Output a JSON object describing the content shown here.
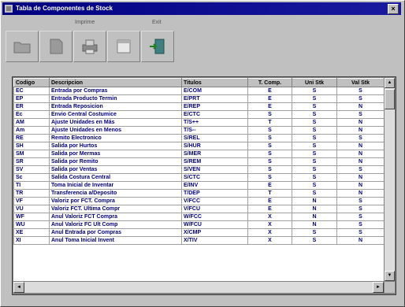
{
  "window": {
    "title": "Tabla de Componentes de Stock",
    "close_label": "×"
  },
  "toolbar": {
    "menu_labels": [
      "Imprime",
      "Exit"
    ],
    "buttons": [
      {
        "icon": "folder-icon"
      },
      {
        "icon": "document-icon"
      },
      {
        "icon": "printer-icon"
      },
      {
        "icon": "window-icon"
      },
      {
        "icon": "exit-door-icon"
      }
    ]
  },
  "grid": {
    "columns": [
      "Codigo",
      "Descripcion",
      "Titulos",
      "T. Comp.",
      "Uni Stk",
      "Val Stk"
    ],
    "rows": [
      [
        "EC",
        "Entrada por Compras",
        "E/COM",
        "E",
        "S",
        "S"
      ],
      [
        "EP",
        "Entrada Producto Termin",
        "E/PRT",
        "E",
        "S",
        "S"
      ],
      [
        "ER",
        "Entrada Reposicion",
        "E/REP",
        "E",
        "S",
        "N"
      ],
      [
        "Ec",
        "Envio Central Costumice",
        "E/CTC",
        "S",
        "S",
        "S"
      ],
      [
        "AM",
        "Ajuste Unidades en Más",
        "T/S++",
        "T",
        "S",
        "N"
      ],
      [
        "Am",
        "Ajuste Unidades en Menos",
        "T/S--",
        "S",
        "S",
        "N"
      ],
      [
        "RE",
        "Remito Electronico",
        "S/REL",
        "S",
        "S",
        "S"
      ],
      [
        "SH",
        "Salida por Hurtos",
        "S/HUR",
        "S",
        "S",
        "N"
      ],
      [
        "SM",
        "Salida por Mermas",
        "S/MER",
        "S",
        "S",
        "N"
      ],
      [
        "SR",
        "Salida por Remito",
        "S/REM",
        "S",
        "S",
        "N"
      ],
      [
        "SV",
        "Salida por Ventas",
        "S/VEN",
        "S",
        "S",
        "S"
      ],
      [
        "Sc",
        "Salida Costura Central",
        "S/CTC",
        "S",
        "S",
        "N"
      ],
      [
        "TI",
        "Toma Inicial de Inventar",
        "E/INV",
        "E",
        "S",
        "N"
      ],
      [
        "TR",
        "Transferencia a/Deposito",
        "T/DEP",
        "T",
        "S",
        "N"
      ],
      [
        "VF",
        "Valoriz por FCT. Compra",
        "V/FCC",
        "E",
        "N",
        "S"
      ],
      [
        "VU",
        "Valoriz FCT. Ultima Compr",
        "V/FCU",
        "E",
        "N",
        "S"
      ],
      [
        "WF",
        "Anul Valoriz FCT Compra",
        "W/FCC",
        "X",
        "N",
        "S"
      ],
      [
        "WU",
        "Anul Valoriz FC Ult Comp",
        "W/FCU",
        "X",
        "N",
        "S"
      ],
      [
        "XE",
        "Anul Entrada por Compras",
        "X/CMP",
        "X",
        "S",
        "S"
      ],
      [
        "XI",
        "Anul Toma Inicial Invent",
        "X/TIV",
        "X",
        "S",
        "N"
      ]
    ]
  },
  "scrollbars": {
    "up": "▲",
    "down": "▼",
    "left": "◄",
    "right": "►"
  }
}
